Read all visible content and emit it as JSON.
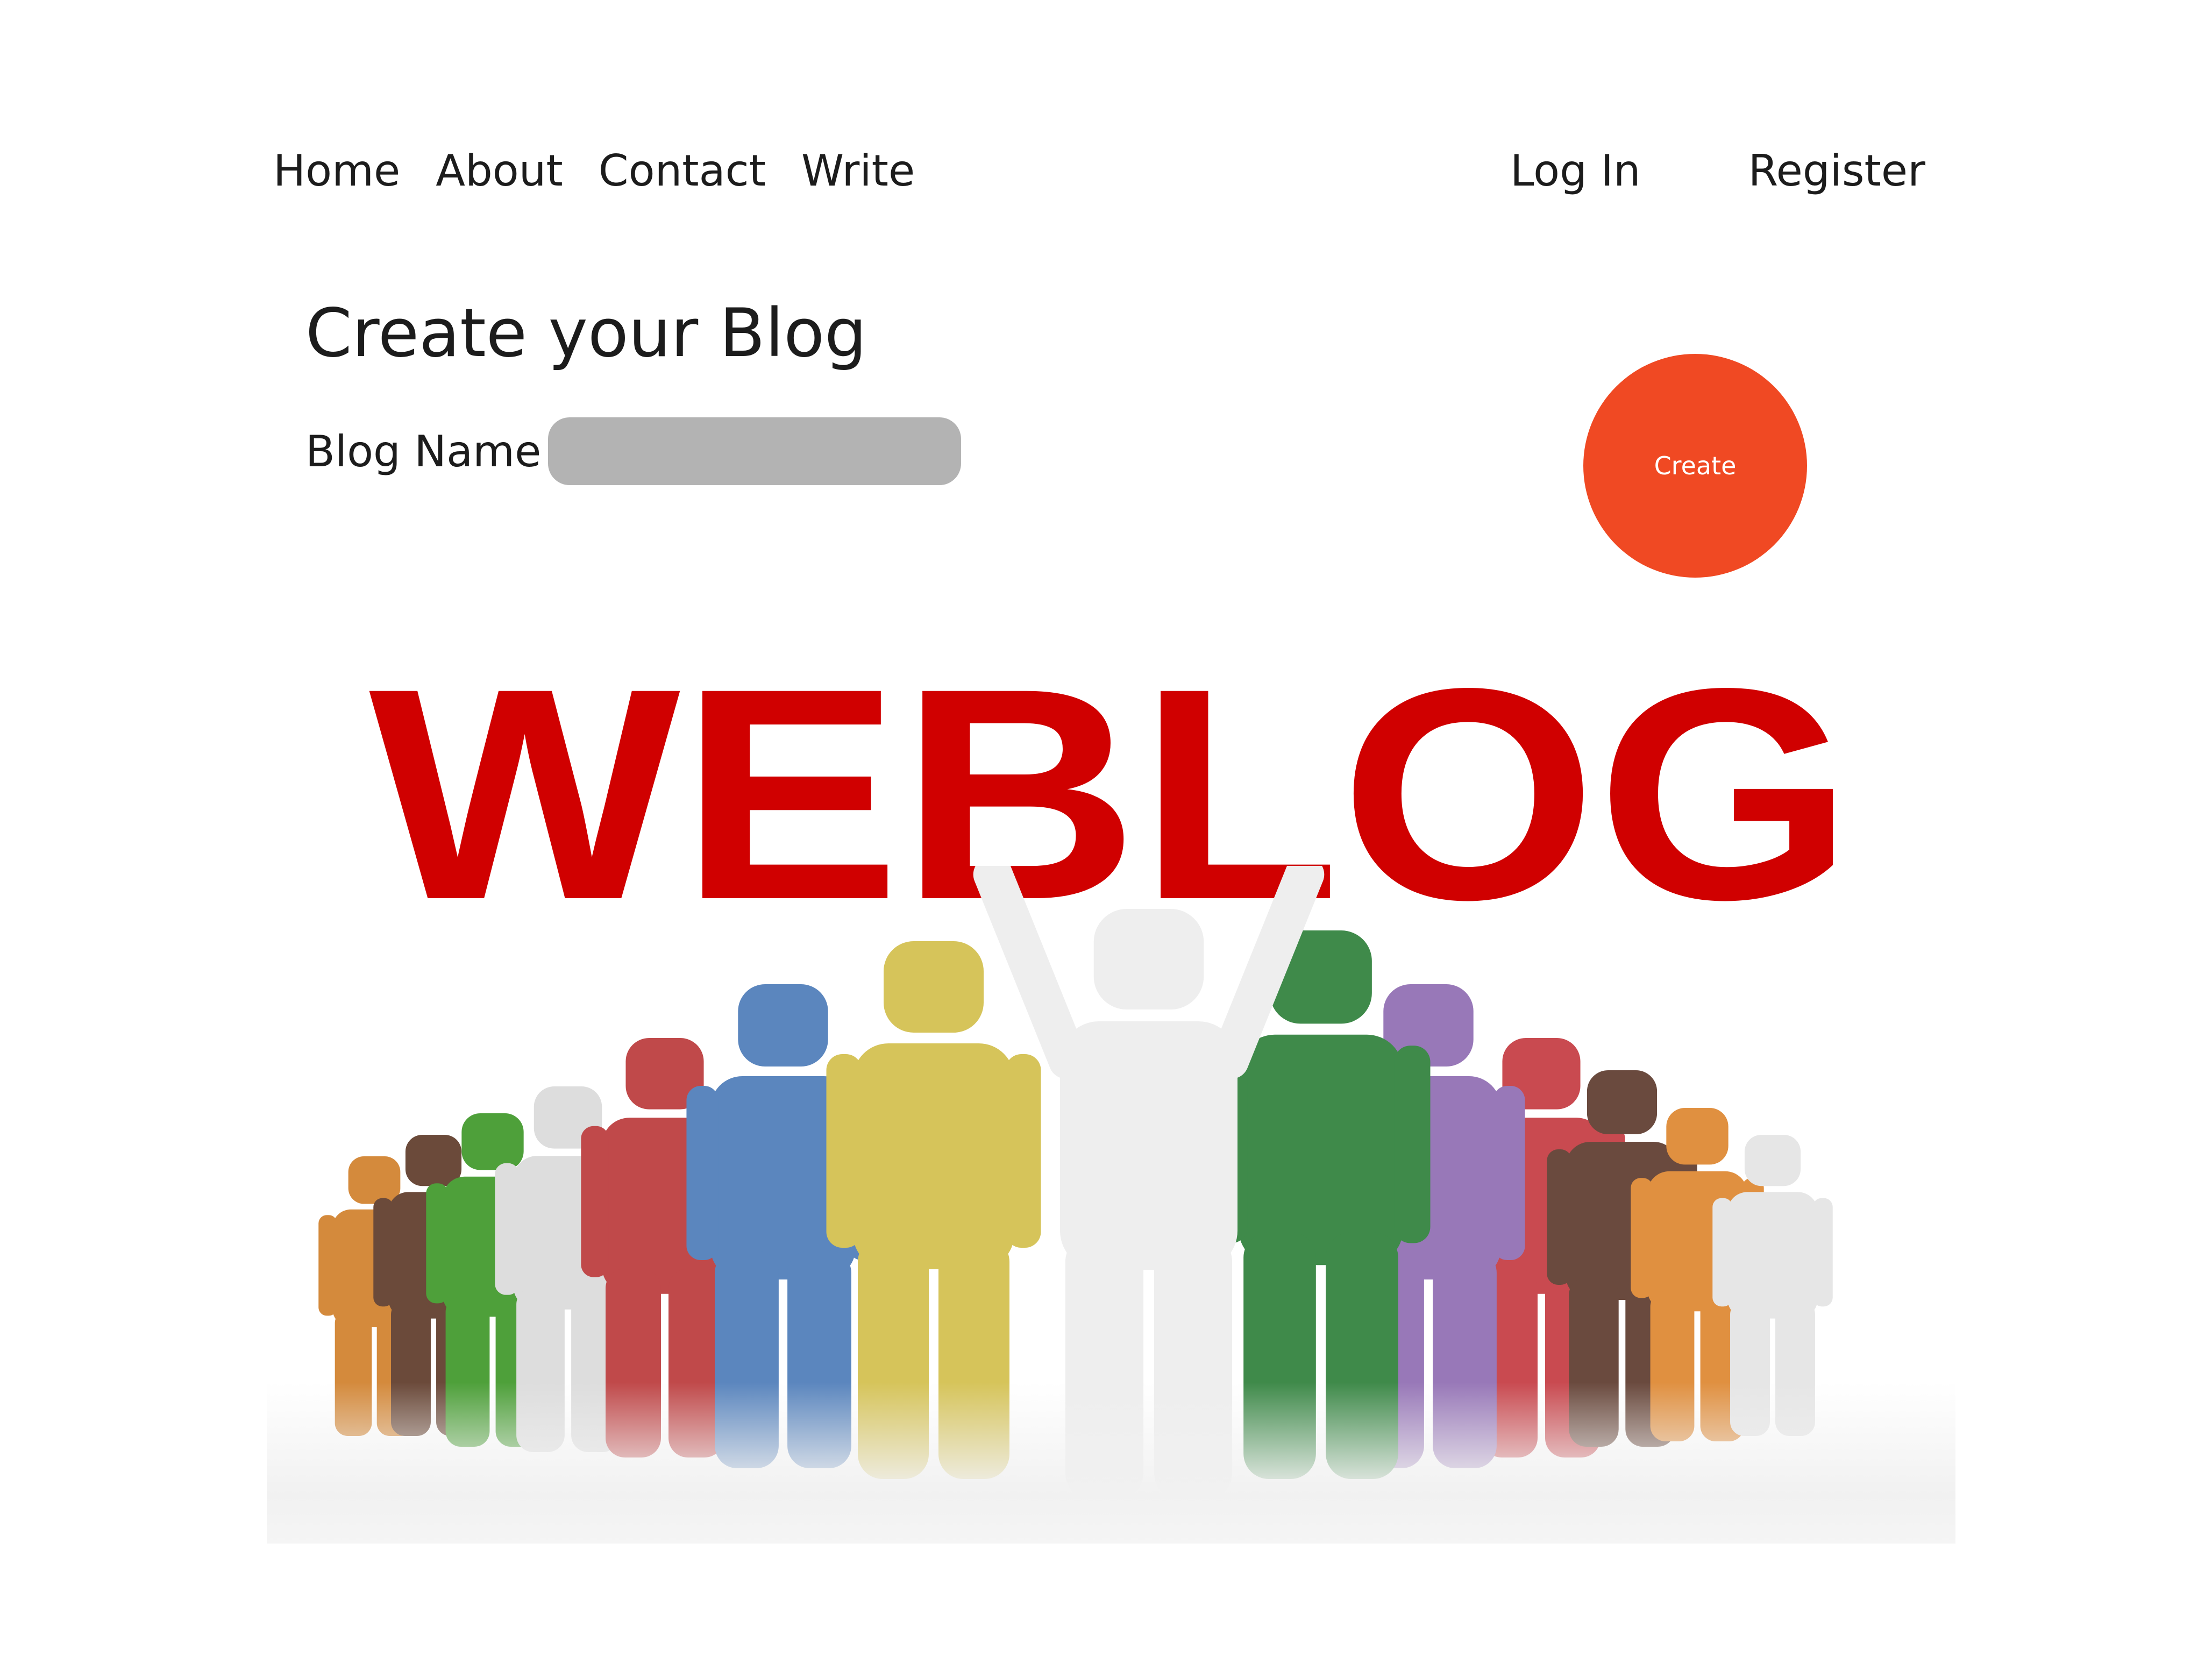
{
  "nav": {
    "items": [
      {
        "label": "Home"
      },
      {
        "label": "About"
      },
      {
        "label": "Contact"
      },
      {
        "label": "Write"
      }
    ],
    "login_label": "Log In",
    "register_label": "Register"
  },
  "form": {
    "title": "Create your Blog",
    "blog_name_label": "Blog Name",
    "blog_name_value": "",
    "create_label": "Create"
  },
  "hero": {
    "wordmark": "WEBLOG",
    "wordmark_color": "#d00000",
    "figure_colors": [
      "#d48a3c",
      "#6b4a3a",
      "#4ea03a",
      "#dddddd",
      "#c0494a",
      "#5b86be",
      "#d6c45a",
      "#eeeeee",
      "#3f8a4a",
      "#9878b8",
      "#6a4a3e",
      "#c94a50",
      "#e09040",
      "#e6e6e6"
    ]
  },
  "colors": {
    "accent": "#f04923",
    "input_bg": "#b3b3b3",
    "text": "#1c1c1c"
  }
}
